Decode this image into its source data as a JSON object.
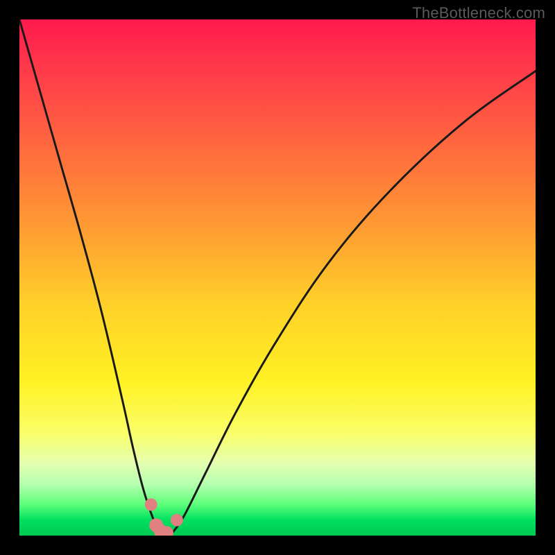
{
  "watermark": {
    "text": "TheBottleneck.com"
  },
  "colors": {
    "frame": "#000000",
    "curve_stroke": "#1a1a1a",
    "marker_fill": "#e08080",
    "marker_stroke": "#b05a5a"
  },
  "chart_data": {
    "type": "line",
    "title": "",
    "xlabel": "",
    "ylabel": "",
    "xlim": [
      0,
      100
    ],
    "ylim": [
      0,
      100
    ],
    "note": "x is normalized horizontal position (0=left edge of plot, 100=right); y is bottleneck percentage (0=no bottleneck at bottom, 100=max at top). Values estimated from gradient position of the plotted curve.",
    "series": [
      {
        "name": "bottleneck-curve",
        "x": [
          0,
          4,
          8,
          12,
          16,
          20,
          22,
          24,
          26,
          27,
          28,
          29,
          30,
          32,
          36,
          42,
          50,
          60,
          72,
          86,
          100
        ],
        "y": [
          100,
          86,
          72,
          58,
          43,
          26,
          17,
          9,
          3,
          1,
          0,
          0,
          1,
          4,
          12,
          24,
          38,
          53,
          67,
          80,
          90
        ]
      }
    ],
    "markers": {
      "note": "salmon rounded markers near the curve minimum",
      "points": [
        {
          "x": 25.5,
          "y": 6
        },
        {
          "x": 26.5,
          "y": 2
        },
        {
          "x": 27.5,
          "y": 0.5
        },
        {
          "x": 28.5,
          "y": 0.5
        },
        {
          "x": 30.5,
          "y": 3
        }
      ]
    }
  }
}
